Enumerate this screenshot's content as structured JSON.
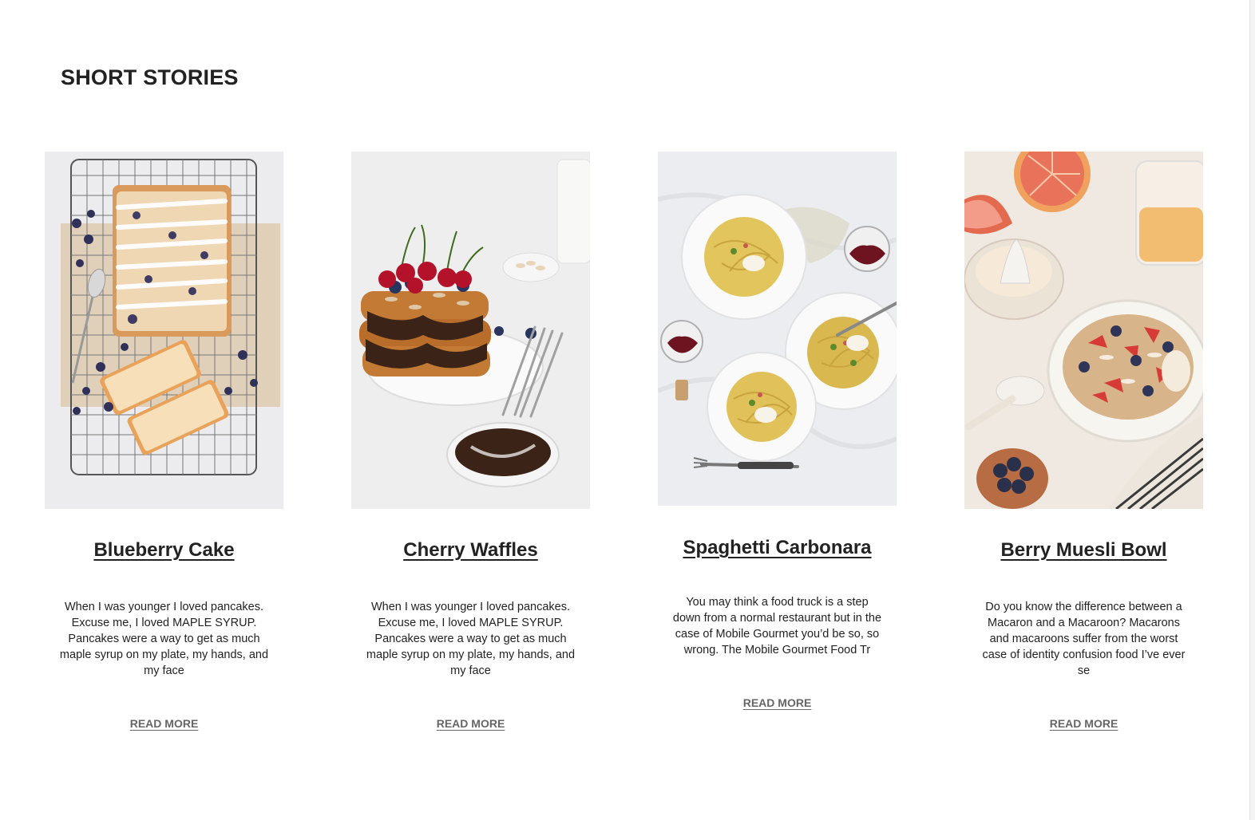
{
  "section": {
    "title": "SHORT STORIES"
  },
  "cards": [
    {
      "title": "Blueberry Cake",
      "excerpt": "When I was younger I loved pancakes. Excuse me, I loved MAPLE SYRUP. Pancakes were a way to get as much maple syrup on my plate, my hands, and my face",
      "read_more": "READ MORE"
    },
    {
      "title": "Cherry Waffles",
      "excerpt": "When I was younger I loved pancakes. Excuse me, I loved MAPLE SYRUP. Pancakes were a way to get as much maple syrup on my plate, my hands, and my face",
      "read_more": "READ MORE"
    },
    {
      "title": "Spaghetti Carbonara",
      "excerpt": "You may think a food truck is a step down from a normal restaurant but in the case of Mobile Gourmet you’d be so, so wrong. The Mobile Gourmet Food Tr",
      "read_more": "READ MORE"
    },
    {
      "title": "Berry Muesli Bowl",
      "excerpt": "Do you know the difference between a Macaron and a Macaroon? Macarons and macaroons suffer from the worst case of identity confusion food I’ve ever se",
      "read_more": "READ MORE"
    }
  ],
  "colors": {
    "text": "#222222",
    "link_muted": "#666666",
    "background": "#ffffff"
  }
}
